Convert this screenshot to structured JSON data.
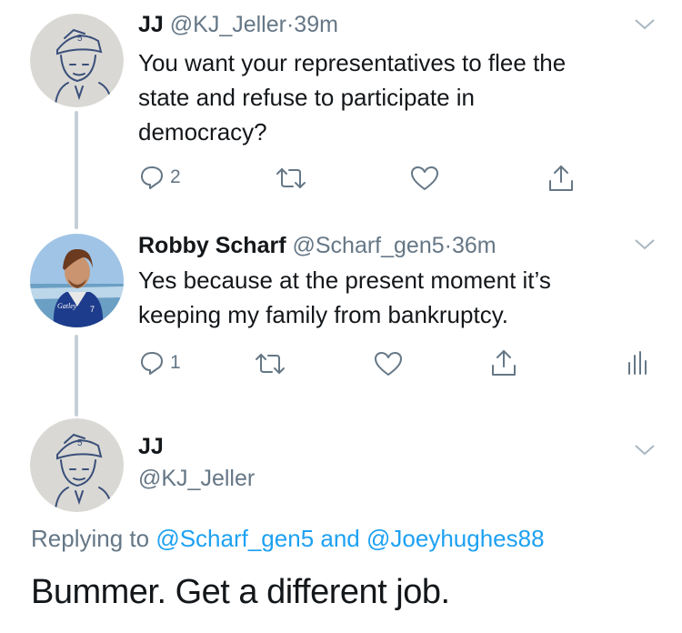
{
  "tweets": [
    {
      "name": "JJ",
      "handle": "@KJ_Jeller",
      "sep": "·",
      "time": "39m",
      "text_lines": [
        "You want your representatives to flee the",
        "state and refuse to participate in",
        "democracy?"
      ],
      "reply_count": "2"
    },
    {
      "name": "Robby Scharf",
      "handle": "@Scharf_gen5",
      "sep": "·",
      "time": "36m",
      "text_lines": [
        "Yes because at the present moment it’s",
        "keeping my family from bankruptcy."
      ],
      "reply_count": "1"
    }
  ],
  "main_tweet": {
    "name": "JJ",
    "handle": "@KJ_Jeller",
    "replying_prefix": "Replying to",
    "replying_user1": "@Scharf_gen5",
    "replying_and": "and",
    "replying_user2": "@Joeyhughes88",
    "text": "Bummer. Get a different job."
  },
  "icons": [
    "reply-icon",
    "retweet-icon",
    "like-icon",
    "share-icon",
    "analytics-icon",
    "chevron-down-icon"
  ],
  "colors": {
    "text": "#14171a",
    "secondary": "#657786",
    "link": "#1da1f2",
    "thread_line": "#c4cfd6"
  }
}
